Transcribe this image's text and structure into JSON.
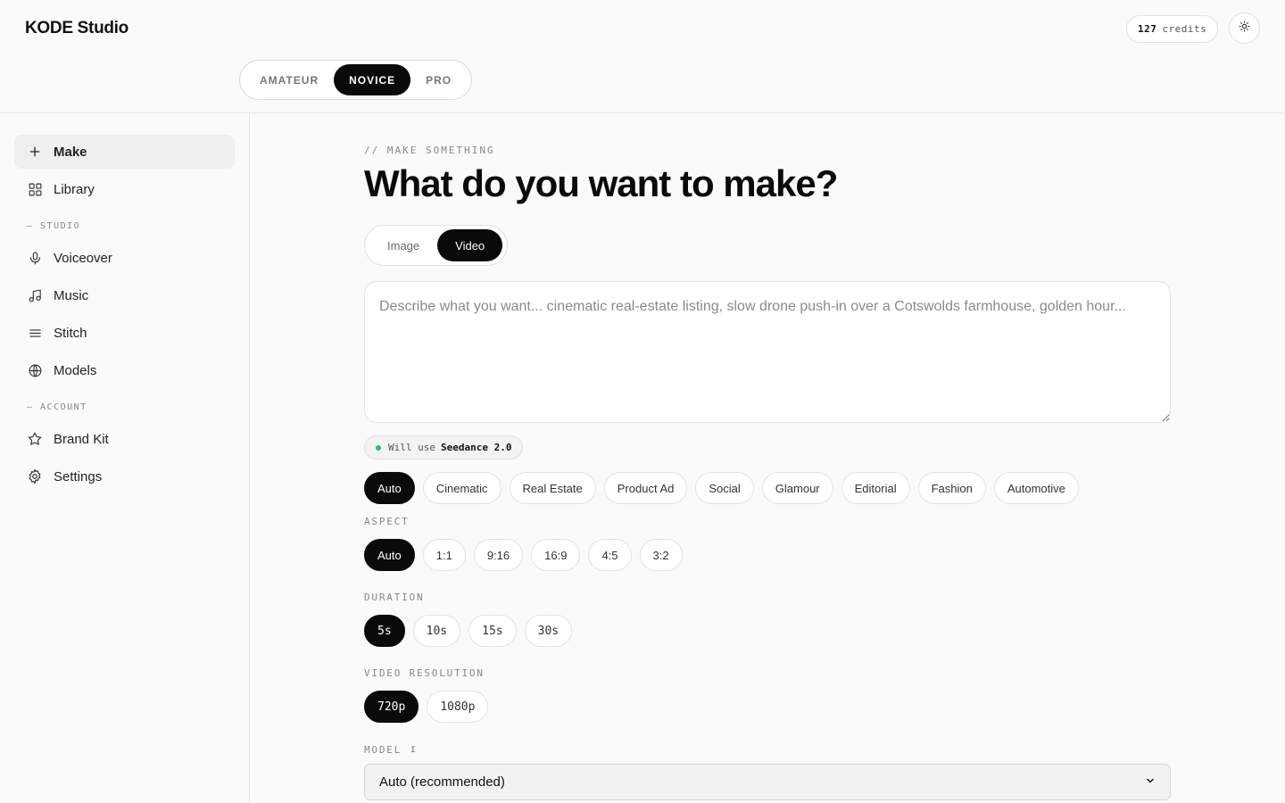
{
  "app": {
    "title": "KODE Studio"
  },
  "header": {
    "credits_value": "127",
    "credits_label": "credits",
    "theme_toggle_icon": "sun-icon",
    "levels": [
      "AMATEUR",
      "NOVICE",
      "PRO"
    ],
    "active_level": "NOVICE"
  },
  "sidebar": {
    "primary": [
      {
        "label": "Make",
        "icon": "plus-icon",
        "active": true
      },
      {
        "label": "Library",
        "icon": "grid-icon",
        "active": false
      }
    ],
    "studio_label": "— STUDIO",
    "studio": [
      {
        "label": "Voiceover",
        "icon": "mic-icon"
      },
      {
        "label": "Music",
        "icon": "music-note-icon"
      },
      {
        "label": "Stitch",
        "icon": "lines-icon"
      },
      {
        "label": "Models",
        "icon": "globe-icon"
      }
    ],
    "account_label": "— ACCOUNT",
    "account": [
      {
        "label": "Brand Kit",
        "icon": "star-icon"
      },
      {
        "label": "Settings",
        "icon": "gear-icon"
      }
    ]
  },
  "main": {
    "eyebrow": "// MAKE SOMETHING",
    "title": "What do you want to make?",
    "modes": [
      "Image",
      "Video"
    ],
    "active_mode": "Video",
    "prompt_placeholder": "Describe what you want... cinematic real-estate listing, slow drone push-in over a Cotswolds farmhouse, golden hour...",
    "prompt_value": "",
    "model_hint_prefix": "Will use",
    "model_hint_name": "Seedance 2.0",
    "styles": [
      "Auto",
      "Cinematic",
      "Real Estate",
      "Product Ad",
      "Social",
      "Glamour",
      "Editorial",
      "Fashion",
      "Automotive"
    ],
    "active_style": "Auto",
    "aspect_label": "ASPECT",
    "aspects": [
      "Auto",
      "1:1",
      "9:16",
      "16:9",
      "4:5",
      "3:2"
    ],
    "active_aspect": "Auto",
    "duration_label": "DURATION",
    "durations": [
      "5s",
      "10s",
      "15s",
      "30s"
    ],
    "active_duration": "5s",
    "resolution_label": "VIDEO RESOLUTION",
    "resolutions": [
      "720p",
      "1080p"
    ],
    "active_resolution": "720p",
    "model_label": "MODEL",
    "model_info_icon": "info-icon",
    "model_info_glyph": "I",
    "model_selected": "Auto (recommended)"
  },
  "colors": {
    "accent": "#0a0a0a",
    "background": "#fafafa",
    "status_dot": "#22c55e"
  }
}
